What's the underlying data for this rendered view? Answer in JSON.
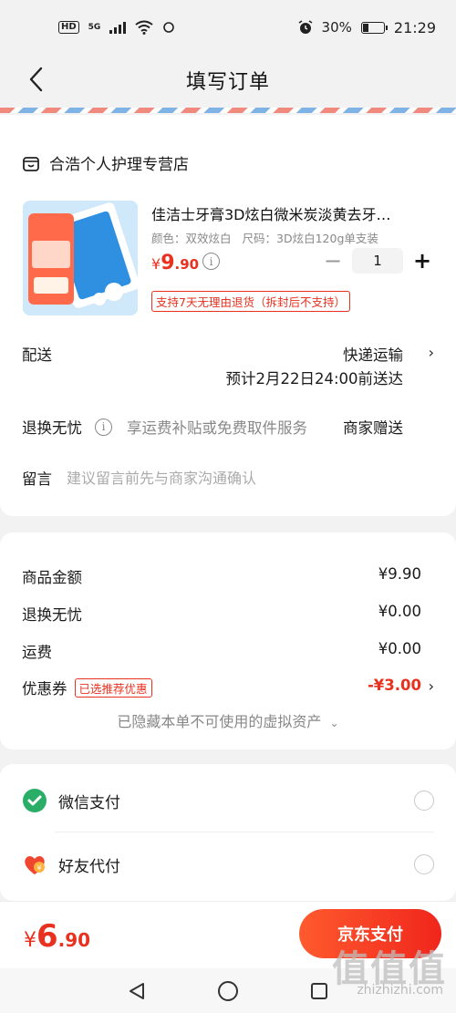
{
  "status_bar": {
    "hd": "HD",
    "network": "5G",
    "battery_level": 0.3,
    "battery_text": "30%",
    "time": "21:29"
  },
  "header": {
    "title": "填写订单"
  },
  "shop": {
    "name": "合浩个人护理专营店"
  },
  "product": {
    "title": "佳洁士牙膏3D炫白微米炭淡黄去牙…",
    "color_spec": "颜色：双效炫白",
    "size_spec": "尺码：3D炫白120g单支装",
    "price_symbol": "¥",
    "price_int": "9",
    "price_dec": ".90",
    "quantity": "1",
    "return_tag": "支持7天无理由退货（拆封后不支持）"
  },
  "shipping": {
    "label": "配送",
    "method": "快递运输",
    "eta": "预计2月22日24:00前送达"
  },
  "return_service": {
    "label": "退换无忧",
    "desc": "享运费补贴或免费取件服务",
    "value": "商家赠送"
  },
  "message": {
    "label": "留言",
    "placeholder": "建议留言前先与商家沟通确认"
  },
  "summary": {
    "items": [
      {
        "label": "商品金额",
        "value": "¥9.90"
      },
      {
        "label": "退换无忧",
        "value": "¥0.00"
      },
      {
        "label": "运费",
        "value": "¥0.00"
      }
    ],
    "coupon_label": "优惠券",
    "coupon_tag": "已选推荐优惠",
    "coupon_value": "-¥3.00",
    "hidden_note": "已隐藏本单不可使用的虚拟资产"
  },
  "payment": {
    "options": [
      {
        "label": "微信支付",
        "icon": "wechat-pay-icon"
      },
      {
        "label": "好友代付",
        "icon": "friend-pay-icon"
      }
    ]
  },
  "bottom": {
    "total_symbol": "¥",
    "total_int": "6",
    "total_dec": ".90",
    "pay_button": "京东支付"
  },
  "watermark": {
    "text": "值值值",
    "sub": "zhizhizhi.com"
  },
  "colors": {
    "accent": "#e8311f",
    "wechat": "#2aae67"
  }
}
